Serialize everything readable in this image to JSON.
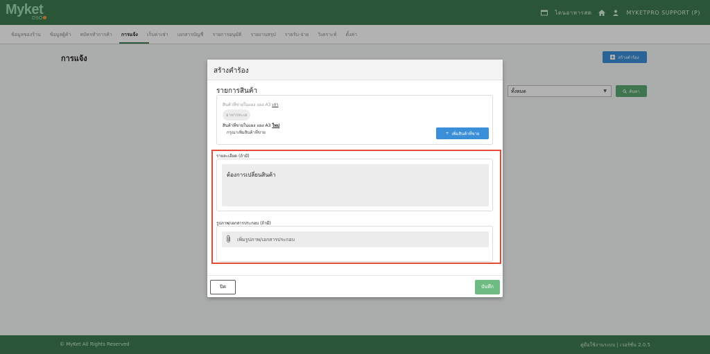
{
  "header": {
    "logo": "Myket",
    "logo_sub": "DSO",
    "shop_link": "ไดนอาหารสด",
    "user": "MYKETPRO SUPPORT (P)"
  },
  "menu": {
    "items": [
      {
        "label": "ข้อมูลของร้าน"
      },
      {
        "label": "ข้อมูลผู้ค้า"
      },
      {
        "label": "สมัครทำการค้า"
      },
      {
        "label": "การแจ้ง"
      },
      {
        "label": "เก็บค่าเช่า"
      },
      {
        "label": "เอกสารบัญชี"
      },
      {
        "label": "รายการอนุมัติ"
      },
      {
        "label": "รายงานสรุป"
      },
      {
        "label": "รายรับ-จ่าย"
      },
      {
        "label": "วิเคราะห์"
      },
      {
        "label": "ตั้งค่า"
      }
    ],
    "active_index": 3
  },
  "page": {
    "title": "การแจ้ง",
    "create_button": "สร้างคำร้อง",
    "filter_value": "ทั้งหมด",
    "search_button": "ค้นหา"
  },
  "modal": {
    "title": "สร้างคำร้อง",
    "section_title": "รายการสินค้า",
    "product_line1": "สินค้าที่ขายในแผง แผง A3",
    "product_line1_tag": "เก่า",
    "product_chip": "อาหารทะเล",
    "product_line2": "สินค้าที่ขายในแผง แผง A3",
    "product_line2_tag": "ใหม่",
    "product_line3": "กรุณาเพิ่มสินค้าที่ขาย",
    "add_product_button": "เพิ่มสินค้าที่ขาย",
    "detail_label": "รายละเอียด (ถ้ามี)",
    "detail_value": "ต้องการเปลี่ยนสินค้า",
    "attach_label": "รูปภาพ/เอกสารประกอบ (ถ้ามี)",
    "attach_placeholder": "เพิ่มรูปภาพ/เอกสารประกอบ",
    "close_button": "ปิด",
    "save_button": "บันทึก"
  },
  "footer": {
    "copyright": "© MyKet All Rights Reserved",
    "right_text": "คู่มือใช้งานระบบ | เวอร์ชั่น 2.0.5"
  },
  "colors": {
    "brand_green": "#3d7a4e",
    "primary_blue": "#3b8fd8",
    "save_green": "#6fbb84",
    "highlight_red": "#e64a34"
  }
}
